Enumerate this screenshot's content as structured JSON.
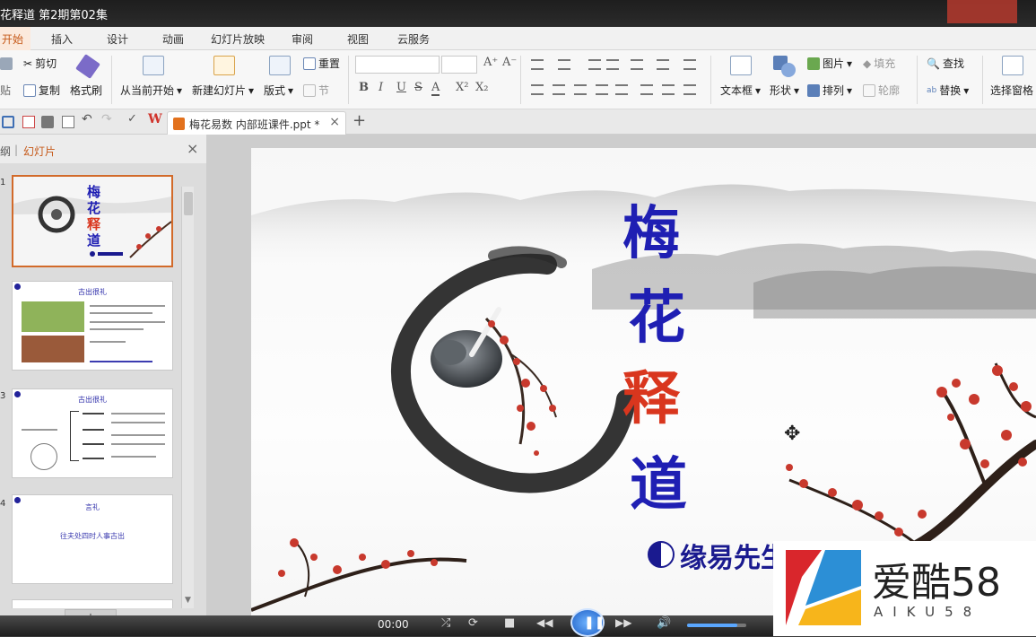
{
  "window": {
    "title": "花释道 第2期第02集"
  },
  "ribbon_tabs": [
    "开始",
    "插入",
    "设计",
    "动画",
    "幻灯片放映",
    "审阅",
    "视图",
    "云服务"
  ],
  "ribbon": {
    "cut": "剪切",
    "paste": "贴",
    "copy": "复制",
    "format_painter": "格式刷",
    "from_current": "从当前开始",
    "new_slide": "新建幻灯片",
    "layout": "版式",
    "reset": "重置",
    "section": "节",
    "textbox": "文本框",
    "shape": "形状",
    "picture": "图片",
    "fill": "填充",
    "arrange": "排列",
    "outline": "轮廓",
    "find": "查找",
    "replace": "替换",
    "selection_pane": "选择窗格",
    "font_bold": "B",
    "font_italic": "I",
    "font_underline": "U",
    "font_strike": "S",
    "font_color": "A",
    "superscript": "X²",
    "subscript": "X₂",
    "grow_font": "A⁺",
    "shrink_font": "A⁻"
  },
  "document_tab": {
    "name": "梅花易数 内部班课件.ppt *",
    "close": "×",
    "add": "+"
  },
  "panel": {
    "outline_tab": "纲",
    "slides_tab": "幻灯片",
    "close": "×",
    "slide_numbers": [
      "1",
      "3",
      "4"
    ],
    "slide2_title": "古出很礼",
    "slide3_title": "古出很礼",
    "slide4_title": "言礼",
    "slide4_body": "往夫处四时人事古出",
    "add_slide": "+"
  },
  "slide": {
    "title_chars": [
      "梅",
      "花",
      "释",
      "道"
    ],
    "signature": "缘易先生"
  },
  "player": {
    "time": "00:00",
    "volume_level": 0.85
  },
  "watermark": {
    "brand": "爱酷58",
    "sub": "AIKU58"
  },
  "colors": {
    "accent": "#c65a1a",
    "title_blue": "#1f1fb3",
    "title_red": "#d9361e",
    "blossom": "#c8392d"
  }
}
